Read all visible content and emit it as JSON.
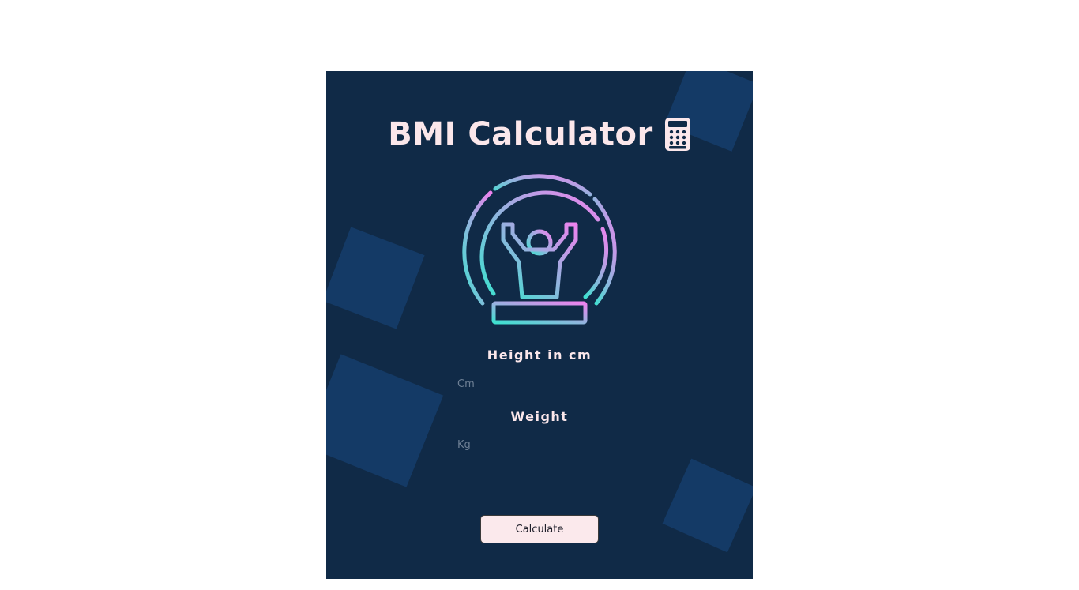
{
  "app": {
    "title": "BMI Calculator",
    "title_icon": "calculator-icon",
    "hero_icon": "person-lifting-gauge-icon"
  },
  "form": {
    "height_label": "Height in cm",
    "height_placeholder": "Cm",
    "height_value": "",
    "weight_label": "Weight",
    "weight_placeholder": "Kg",
    "weight_value": "",
    "submit_label": "Calculate"
  },
  "colors": {
    "card_background": "#102a47",
    "decor_squares": "#143a66",
    "text": "#fbe7eb",
    "gradient_start": "#3fe0d0",
    "gradient_end": "#ee82ee",
    "button_background": "#fbe9ec"
  }
}
